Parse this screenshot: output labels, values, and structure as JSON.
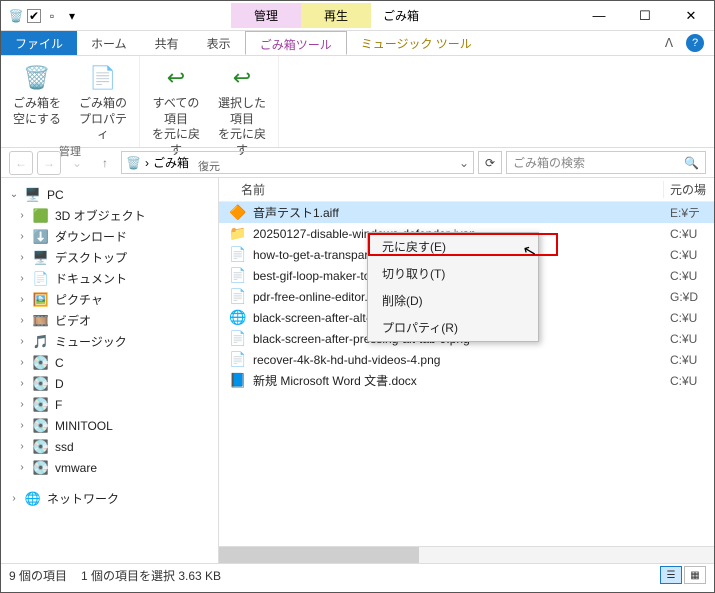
{
  "window": {
    "title": "ごみ箱",
    "contextual": [
      {
        "label": "管理"
      },
      {
        "label": "再生"
      }
    ]
  },
  "ribbon": {
    "file": "ファイル",
    "tabs": [
      "ホーム",
      "共有",
      "表示"
    ],
    "toolTabs": [
      "ごみ箱ツール",
      "ミュージック ツール"
    ],
    "groups": [
      {
        "name": "管理",
        "buttons": [
          {
            "label": "ごみ箱を\n空にする",
            "icon": "🗑️"
          },
          {
            "label": "ごみ箱の\nプロパティ",
            "icon": "📄"
          }
        ]
      },
      {
        "name": "復元",
        "buttons": [
          {
            "label": "すべての項目\nを元に戻す",
            "icon": "↩"
          },
          {
            "label": "選択した項目\nを元に戻す",
            "icon": "↩"
          }
        ]
      }
    ]
  },
  "address": {
    "location": "ごみ箱",
    "searchPlaceholder": "ごみ箱の検索"
  },
  "sidebar": {
    "pc": "PC",
    "items": [
      {
        "icon": "🟩",
        "label": "3D オブジェクト"
      },
      {
        "icon": "⬇️",
        "label": "ダウンロード"
      },
      {
        "icon": "🖥️",
        "label": "デスクトップ"
      },
      {
        "icon": "📄",
        "label": "ドキュメント"
      },
      {
        "icon": "🖼️",
        "label": "ピクチャ"
      },
      {
        "icon": "🎞️",
        "label": "ビデオ"
      },
      {
        "icon": "🎵",
        "label": "ミュージック"
      },
      {
        "icon": "💽",
        "label": "C"
      },
      {
        "icon": "💽",
        "label": "D"
      },
      {
        "icon": "💽",
        "label": "F"
      },
      {
        "icon": "💽",
        "label": "MINITOOL"
      },
      {
        "icon": "💽",
        "label": "ssd"
      },
      {
        "icon": "💽",
        "label": "vmware"
      }
    ],
    "network": "ネットワーク"
  },
  "columns": {
    "name": "名前",
    "loc": "元の場"
  },
  "files": [
    {
      "icon": "🔶",
      "name": "音声テスト1.aiff",
      "loc": "E:¥テ",
      "selected": true
    },
    {
      "icon": "📁",
      "name": "20250127-disable-windows-defender-ivan",
      "loc": "C:¥U"
    },
    {
      "icon": "📄",
      "name": "how-to-get-a-transparent-profile-1.png",
      "loc": "C:¥U"
    },
    {
      "icon": "📄",
      "name": "best-gif-loop-maker-tools-8.png",
      "loc": "C:¥U"
    },
    {
      "icon": "📄",
      "name": "pdr-free-online-editor.png",
      "loc": "G:¥D"
    },
    {
      "icon": "🌐",
      "name": "black-screen-after-alt-tab-thumbnail.webp",
      "loc": "C:¥U"
    },
    {
      "icon": "📄",
      "name": "black-screen-after-pressing-alt-tab-9.png",
      "loc": "C:¥U"
    },
    {
      "icon": "📄",
      "name": "recover-4k-8k-hd-uhd-videos-4.png",
      "loc": "C:¥U"
    },
    {
      "icon": "📘",
      "name": "新規 Microsoft Word 文書.docx",
      "loc": "C:¥U"
    }
  ],
  "contextMenu": [
    "元に戻す(E)",
    "切り取り(T)",
    "削除(D)",
    "プロパティ(R)"
  ],
  "status": {
    "count": "9 個の項目",
    "selection": "1 個の項目を選択 3.63 KB"
  }
}
